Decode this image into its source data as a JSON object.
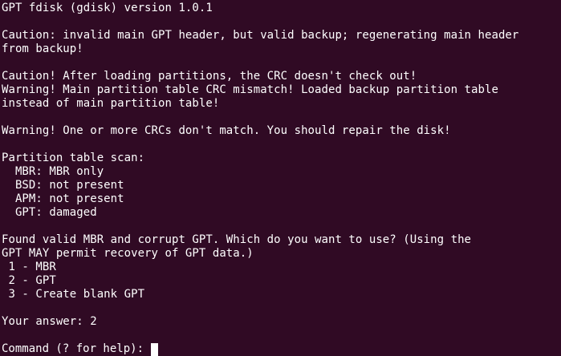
{
  "terminal": {
    "top_partial": "                              (gdisk)",
    "lines": [
      "GPT fdisk (gdisk) version 1.0.1",
      "",
      "Caution: invalid main GPT header, but valid backup; regenerating main header",
      "from backup!",
      "",
      "Caution! After loading partitions, the CRC doesn't check out!",
      "Warning! Main partition table CRC mismatch! Loaded backup partition table",
      "instead of main partition table!",
      "",
      "Warning! One or more CRCs don't match. You should repair the disk!",
      "",
      "Partition table scan:",
      "  MBR: MBR only",
      "  BSD: not present",
      "  APM: not present",
      "  GPT: damaged",
      "",
      "Found valid MBR and corrupt GPT. Which do you want to use? (Using the",
      "GPT MAY permit recovery of GPT data.)",
      " 1 - MBR",
      " 2 - GPT",
      " 3 - Create blank GPT",
      "",
      "Your answer: 2",
      ""
    ],
    "prompt": "Command (? for help): ",
    "background_color": "#300a24",
    "text_color": "#ffffff"
  }
}
